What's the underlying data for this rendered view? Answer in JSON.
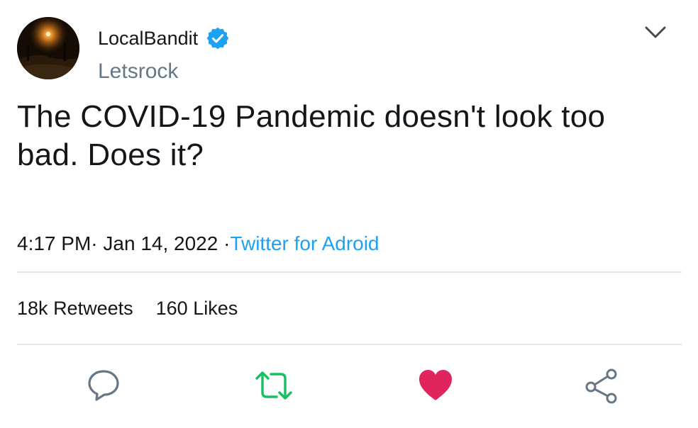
{
  "tweet": {
    "author": {
      "display_name": "LocalBandit",
      "handle": "Letsrock",
      "verified": true
    },
    "text": "The COVID-19 Pandemic doesn't look too bad. Does it?",
    "time": "4:17 PM",
    "separator_1": "·",
    "date": "Jan 14, 2022",
    "separator_2": "·",
    "source": "Twitter for Adroid",
    "stats": {
      "retweets_count": "18k",
      "retweets_label": "Retweets",
      "likes_count": "160",
      "likes_label": "Likes"
    }
  },
  "icons": {
    "menu": "chevron-down-icon",
    "verified": "verified-badge-icon",
    "reply": "reply-icon",
    "retweet": "retweet-icon",
    "like": "heart-icon",
    "share": "share-icon"
  },
  "colors": {
    "link": "#1da1f2",
    "handle": "#657786",
    "verified": "#1da1f2",
    "retweet": "#17bf63",
    "like": "#e0245e",
    "icon_gray": "#657786",
    "divider": "#e1e8ed"
  }
}
